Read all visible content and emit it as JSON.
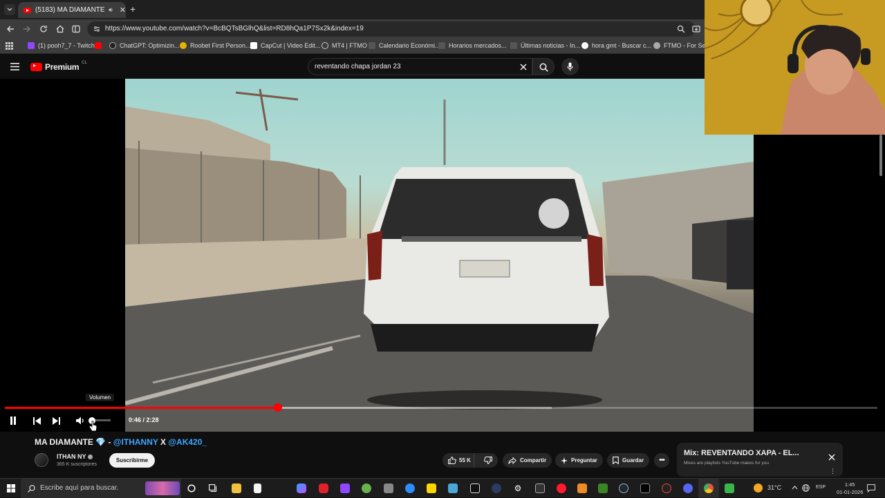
{
  "browser": {
    "tab_title": "(5183) MA DIAMANTE 💎 -",
    "url": "https://www.youtube.com/watch?v=BcBQTsBGlhQ&list=RD8hQa1P7Sx2k&index=19",
    "bookmarks": [
      "(1) pooh7_7 - Twitch",
      "ChatGPT: Optimizin...",
      "Roobet First Person...",
      "CapCut | Video Edit...",
      "MT4 | FTMO",
      "Calendario Económi...",
      "Horarios mercados...",
      "Últimas noticias - In...",
      "hora gmt - Buscar c...",
      "FTMO - For Senio"
    ]
  },
  "youtube": {
    "logo_text": "Premium",
    "logo_region": "CL",
    "search_value": "reventando chapa jordan 23"
  },
  "player": {
    "time_display": "0:46 / 2:28",
    "volume_tooltip": "Volumen",
    "progress_played": 0.313,
    "progress_buffered": 0.627,
    "volume_level": 0.1
  },
  "video_info": {
    "title_main": "MA DIAMANTE 💎 - ",
    "mention_1": "@ITHANNY",
    "title_sep": " X ",
    "mention_2": "@AK420_",
    "channel": "ITHAN NY",
    "subscribers": "365 K suscriptores",
    "subscribe_label": "Suscribirme",
    "likes": "55 K",
    "share_label": "Compartir",
    "ask_label": "Preguntar",
    "save_label": "Guardar"
  },
  "mix": {
    "title": "Mix: REVENTANDO XAPA - EL...",
    "subtitle": "Mixes are playlists YouTube makes for you"
  },
  "taskbar": {
    "search_placeholder": "Escribe aquí para buscar.",
    "temperature": "31°C",
    "language": "ESP",
    "time": "1:45",
    "date": "01-01-2026"
  },
  "colors": {
    "youtube_red": "#ff0000",
    "link_blue": "#3ea6ff",
    "background": "#0f0f0f"
  }
}
